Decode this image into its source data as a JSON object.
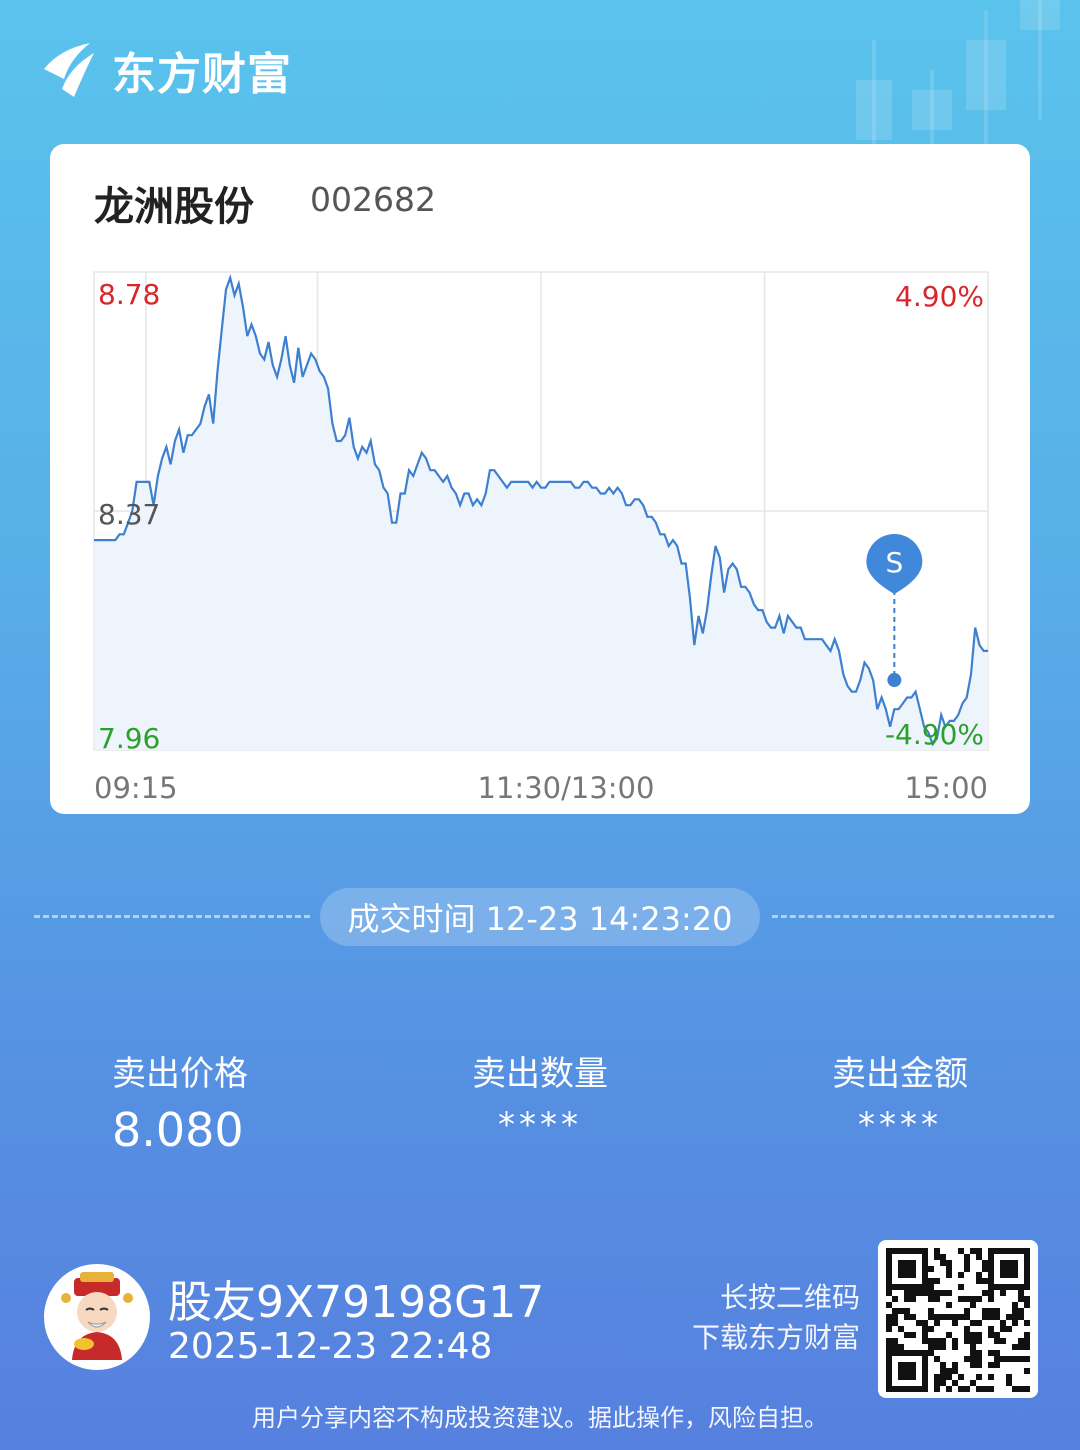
{
  "brand": {
    "name": "东方财富",
    "logo_icon": "eastmoney-logo-icon"
  },
  "stock": {
    "name": "龙洲股份",
    "code": "002682"
  },
  "chart_data": {
    "type": "line",
    "title": "",
    "y_left_ticks": [
      "8.78",
      "8.37",
      "7.96"
    ],
    "y_right_ticks": [
      "4.90%",
      "-4.90%"
    ],
    "x_ticks": [
      "09:15",
      "11:30/13:00",
      "15:00"
    ],
    "ylim": [
      7.96,
      8.78
    ],
    "prev_close": 8.37,
    "colors": {
      "line": "#3d80d0",
      "fill": "#eef4fc",
      "up": "#d8262c",
      "down": "#2ca02c",
      "neutral": "#555555",
      "grid": "#e6e6e6"
    },
    "series": [
      {
        "values": [
          8.32,
          8.32,
          8.32,
          8.32,
          8.32,
          8.32,
          8.33,
          8.33,
          8.35,
          8.37,
          8.42,
          8.42,
          8.42,
          8.42,
          8.38,
          8.43,
          8.46,
          8.48,
          8.45,
          8.49,
          8.51,
          8.47,
          8.5,
          8.5,
          8.51,
          8.52,
          8.55,
          8.57,
          8.52,
          8.61,
          8.68,
          8.75,
          8.77,
          8.74,
          8.76,
          8.72,
          8.67,
          8.69,
          8.67,
          8.64,
          8.63,
          8.66,
          8.62,
          8.6,
          8.63,
          8.67,
          8.62,
          8.59,
          8.65,
          8.6,
          8.62,
          8.64,
          8.63,
          8.61,
          8.6,
          8.58,
          8.52,
          8.49,
          8.49,
          8.5,
          8.53,
          8.48,
          8.46,
          8.48,
          8.47,
          8.49,
          8.45,
          8.44,
          8.41,
          8.4,
          8.35,
          8.35,
          8.4,
          8.4,
          8.44,
          8.43,
          8.45,
          8.47,
          8.46,
          8.44,
          8.44,
          8.43,
          8.42,
          8.43,
          8.41,
          8.4,
          8.38,
          8.4,
          8.4,
          8.38,
          8.39,
          8.38,
          8.4,
          8.44,
          8.44,
          8.43,
          8.42,
          8.41,
          8.42,
          8.42,
          8.42,
          8.42,
          8.42,
          8.41,
          8.42,
          8.41,
          8.41,
          8.42,
          8.42,
          8.42,
          8.42,
          8.42,
          8.42,
          8.41,
          8.41,
          8.42,
          8.42,
          8.41,
          8.41,
          8.4,
          8.4,
          8.41,
          8.4,
          8.41,
          8.4,
          8.38,
          8.38,
          8.39,
          8.39,
          8.38,
          8.36,
          8.36,
          8.35,
          8.33,
          8.33,
          8.31,
          8.32,
          8.31,
          8.28,
          8.28,
          8.22,
          8.14,
          8.19,
          8.16,
          8.2,
          8.26,
          8.31,
          8.29,
          8.23,
          8.27,
          8.28,
          8.27,
          8.24,
          8.24,
          8.23,
          8.21,
          8.2,
          8.2,
          8.18,
          8.17,
          8.17,
          8.19,
          8.16,
          8.19,
          8.18,
          8.17,
          8.17,
          8.15,
          8.15,
          8.15,
          8.15,
          8.15,
          8.14,
          8.13,
          8.15,
          8.13,
          8.09,
          8.07,
          8.06,
          8.06,
          8.08,
          8.11,
          8.1,
          8.08,
          8.03,
          8.05,
          8.03,
          8.0,
          8.03,
          8.03,
          8.04,
          8.05,
          8.05,
          8.06,
          8.03,
          8.0,
          7.99,
          7.97,
          7.98,
          8.02,
          8.0,
          8.01,
          8.01,
          8.02,
          8.04,
          8.05,
          8.09,
          8.17,
          8.14,
          8.13,
          8.13
        ]
      }
    ],
    "marker": {
      "label": "S",
      "time_index": 188,
      "price": 8.08
    }
  },
  "trade": {
    "time_label": "成交时间 12-23 14:23:20"
  },
  "stats": [
    {
      "label": "卖出价格",
      "value": "8.080"
    },
    {
      "label": "卖出数量",
      "value": "****"
    },
    {
      "label": "卖出金额",
      "value": "****"
    }
  ],
  "user": {
    "name": "股友9X79198G17",
    "time": "2025-12-23 22:48",
    "avatar_icon": "caishen-avatar-icon"
  },
  "qr": {
    "hint_line1": "长按二维码",
    "hint_line2": "下载东方财富",
    "icon": "qr-code-icon"
  },
  "disclaimer": "用户分享内容不构成投资建议。据此操作，风险自担。"
}
